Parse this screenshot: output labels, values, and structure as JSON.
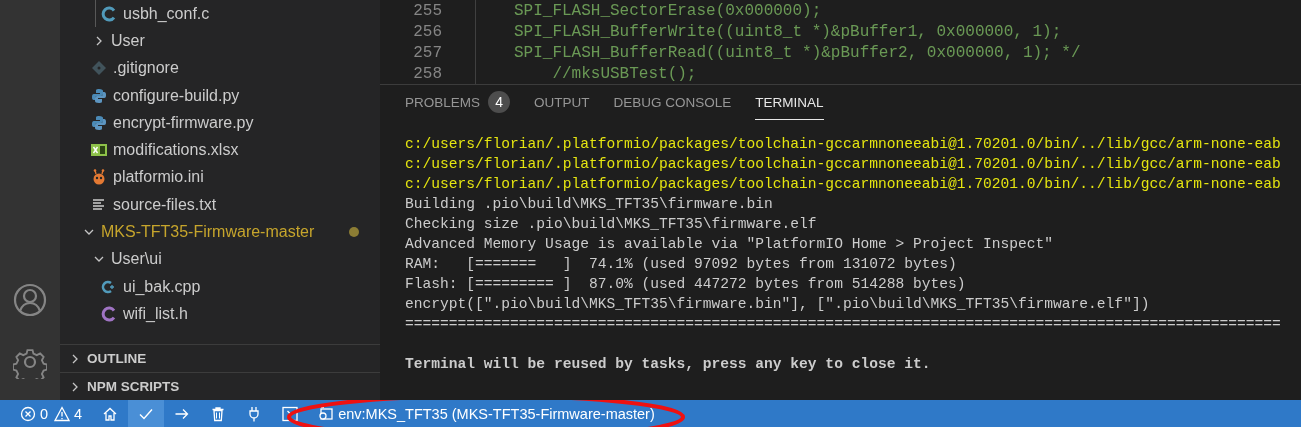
{
  "activity_bar": {
    "items": [
      {
        "kind": "account"
      },
      {
        "kind": "settings"
      }
    ]
  },
  "explorer": {
    "tree": [
      {
        "kind": "continued",
        "children": [
          {
            "kind": "continued",
            "children": [
              {
                "kind": "c-file",
                "label": "usbh_conf.c"
              }
            ]
          },
          {
            "kind": "folder",
            "label": "User",
            "expanded": false
          },
          {
            "kind": "git-file",
            "label": ".gitignore"
          },
          {
            "kind": "python-file",
            "label": "configure-build.py"
          },
          {
            "kind": "python-file",
            "label": "encrypt-firmware.py"
          },
          {
            "kind": "excel-file",
            "label": "modifications.xlsx"
          },
          {
            "kind": "platformio-file",
            "label": "platformio.ini"
          },
          {
            "kind": "text-file",
            "label": "source-files.txt"
          }
        ]
      },
      {
        "kind": "folder",
        "label": "MKS-TFT35-Firmware-master",
        "expanded": true,
        "modified": true,
        "children": [
          {
            "kind": "folder",
            "label": "User\\ui",
            "expanded": true,
            "children": [
              {
                "kind": "cpp-file",
                "label": "ui_bak.cpp"
              },
              {
                "kind": "h-file",
                "label": "wifi_list.h"
              }
            ]
          }
        ]
      }
    ],
    "sections": [
      {
        "label": "OUTLINE",
        "expanded": false
      },
      {
        "label": "NPM SCRIPTS",
        "expanded": false
      }
    ]
  },
  "editor": {
    "lines": [
      {
        "number": "255",
        "text": "SPI_FLASH_SectorErase(0x000000);"
      },
      {
        "number": "256",
        "text": "SPI_FLASH_BufferWrite((uint8_t *)&pBuffer1, 0x000000, 1);"
      },
      {
        "number": "257",
        "text": "SPI_FLASH_BufferRead((uint8_t *)&pBuffer2, 0x000000, 1); */"
      },
      {
        "number": "258",
        "text": "    //mksUSBTest();"
      }
    ]
  },
  "panel": {
    "tabs": [
      {
        "label": "PROBLEMS",
        "badge": "4",
        "selected": false
      },
      {
        "label": "OUTPUT",
        "selected": false
      },
      {
        "label": "DEBUG CONSOLE",
        "selected": false
      },
      {
        "label": "TERMINAL",
        "selected": true
      }
    ],
    "terminal_lines": [
      {
        "kind": "path",
        "text": "c:/users/florian/.platformio/packages/toolchain-gccarmnoneeabi@1.70201.0/bin/../lib/gcc/arm-none-eab"
      },
      {
        "kind": "path",
        "text": "c:/users/florian/.platformio/packages/toolchain-gccarmnoneeabi@1.70201.0/bin/../lib/gcc/arm-none-eab"
      },
      {
        "kind": "path",
        "text": "c:/users/florian/.platformio/packages/toolchain-gccarmnoneeabi@1.70201.0/bin/../lib/gcc/arm-none-eab"
      },
      {
        "kind": "plain",
        "text": "Building .pio\\build\\MKS_TFT35\\firmware.bin"
      },
      {
        "kind": "plain",
        "text": "Checking size .pio\\build\\MKS_TFT35\\firmware.elf"
      },
      {
        "kind": "plain",
        "text": "Advanced Memory Usage is available via \"PlatformIO Home > Project Inspect\""
      },
      {
        "kind": "plain",
        "text": "RAM:   [=======   ]  74.1% (used 97092 bytes from 131072 bytes)"
      },
      {
        "kind": "plain",
        "text": "Flash: [========= ]  87.0% (used 447272 bytes from 514288 bytes)"
      },
      {
        "kind": "plain",
        "text": "encrypt([\".pio\\build\\MKS_TFT35\\firmware.bin\"], [\".pio\\build\\MKS_TFT35\\firmware.elf\"])"
      },
      {
        "kind": "plain",
        "text": "===================================================================================================="
      },
      {
        "kind": "blank"
      },
      {
        "kind": "bold",
        "text": "Terminal will be reused by tasks, press any key to close it."
      }
    ]
  },
  "status_bar": {
    "items": [
      {
        "kind": "errors",
        "text": "0",
        "hovered": false
      },
      {
        "kind": "warnings",
        "text": "4",
        "hovered": false
      },
      {
        "kind": "home",
        "hovered": false
      },
      {
        "kind": "build",
        "hovered": true
      },
      {
        "kind": "upload",
        "hovered": false
      },
      {
        "kind": "clean",
        "hovered": false
      },
      {
        "kind": "serial",
        "hovered": false
      },
      {
        "kind": "terminal",
        "hovered": false
      },
      {
        "kind": "env",
        "text": "env:MKS_TFT35 (MKS-TFT35-Firmware-master)",
        "hovered": false,
        "circled": true
      }
    ]
  }
}
